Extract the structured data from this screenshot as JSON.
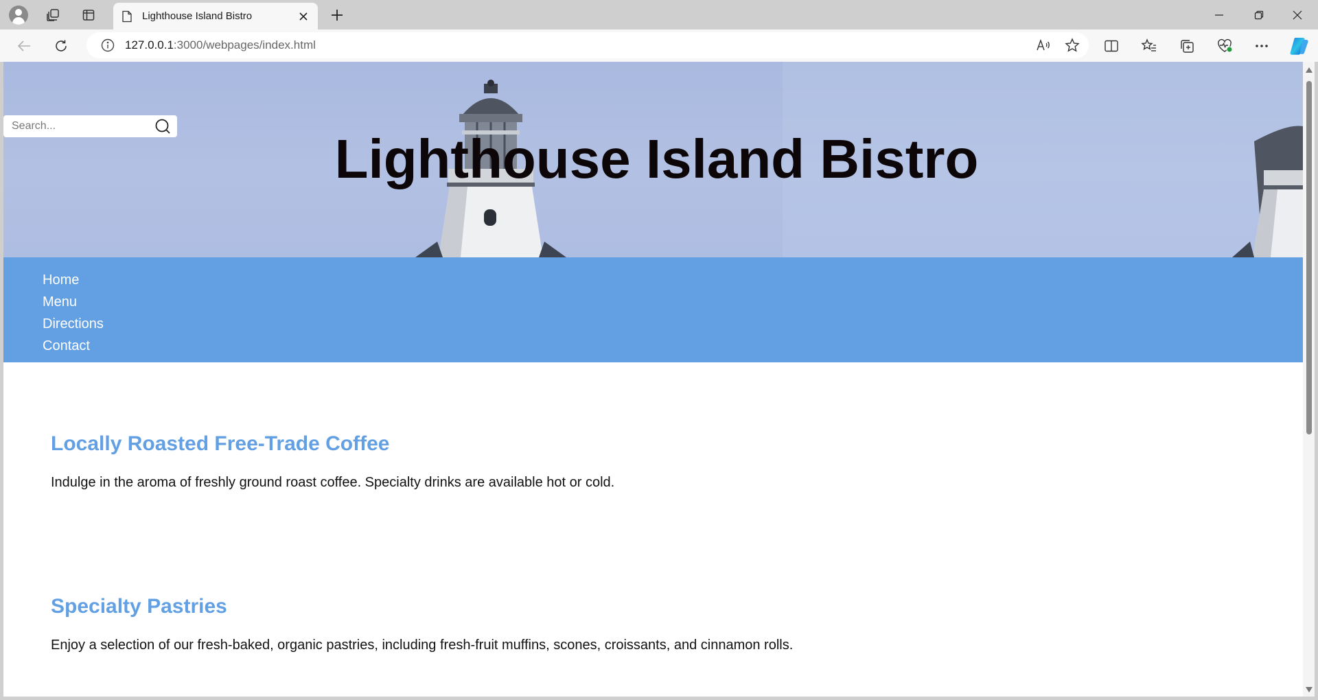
{
  "browser": {
    "tab_title": "Lighthouse Island Bistro",
    "url_host": "127.0.0.1",
    "url_rest": ":3000/webpages/index.html"
  },
  "site": {
    "search_placeholder": "Search...",
    "title": "Lighthouse Island Bistro",
    "nav": [
      "Home",
      "Menu",
      "Directions",
      "Contact"
    ],
    "sections": [
      {
        "heading": "Locally Roasted Free-Trade Coffee",
        "text": "Indulge in the aroma of freshly ground roast coffee. Specialty drinks are available hot or cold."
      },
      {
        "heading": "Specialty Pastries",
        "text": "Enjoy a selection of our fresh-baked, organic pastries, including fresh-fruit muffins, scones, croissants, and cinnamon rolls."
      }
    ],
    "colors": {
      "nav_background": "#62a0e3",
      "heading": "#62a0e3",
      "title": "#0d0608",
      "banner_sky": "#aebde2"
    }
  }
}
